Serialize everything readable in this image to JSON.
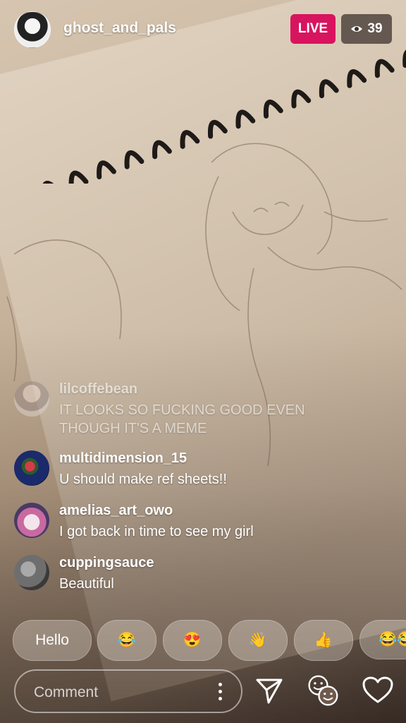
{
  "header": {
    "host_username": "ghost_and_pals",
    "live_label": "LIVE",
    "viewer_count": "39",
    "live_color": "#d8145f"
  },
  "comments": [
    {
      "username": "lilcoffebean",
      "text": "IT LOOKS SO FUCKING GOOD EVEN THOUGH IT'S A MEME",
      "faded": true
    },
    {
      "username": "multidimension_15",
      "text": "U should make ref sheets!!",
      "faded": false
    },
    {
      "username": "amelias_art_owo",
      "text": "I got back in time to see my girl",
      "faded": false
    },
    {
      "username": "cuppingsauce",
      "text": "Beautiful",
      "faded": false
    }
  ],
  "quick_reactions": [
    {
      "label": "Hello",
      "kind": "text"
    },
    {
      "label": "😂",
      "kind": "emoji",
      "icon": "tears-of-joy-icon"
    },
    {
      "label": "😍",
      "kind": "emoji",
      "icon": "heart-eyes-icon"
    },
    {
      "label": "👋",
      "kind": "emoji",
      "icon": "waving-hand-icon"
    },
    {
      "label": "👍",
      "kind": "emoji",
      "icon": "thumbs-up-icon"
    },
    {
      "label": "😂😂",
      "kind": "emoji",
      "icon": "tears-of-joy-icon"
    }
  ],
  "bottom_bar": {
    "comment_placeholder": "Comment",
    "icons": [
      "more-options-icon",
      "send-icon",
      "faces-icon",
      "heart-icon"
    ]
  }
}
